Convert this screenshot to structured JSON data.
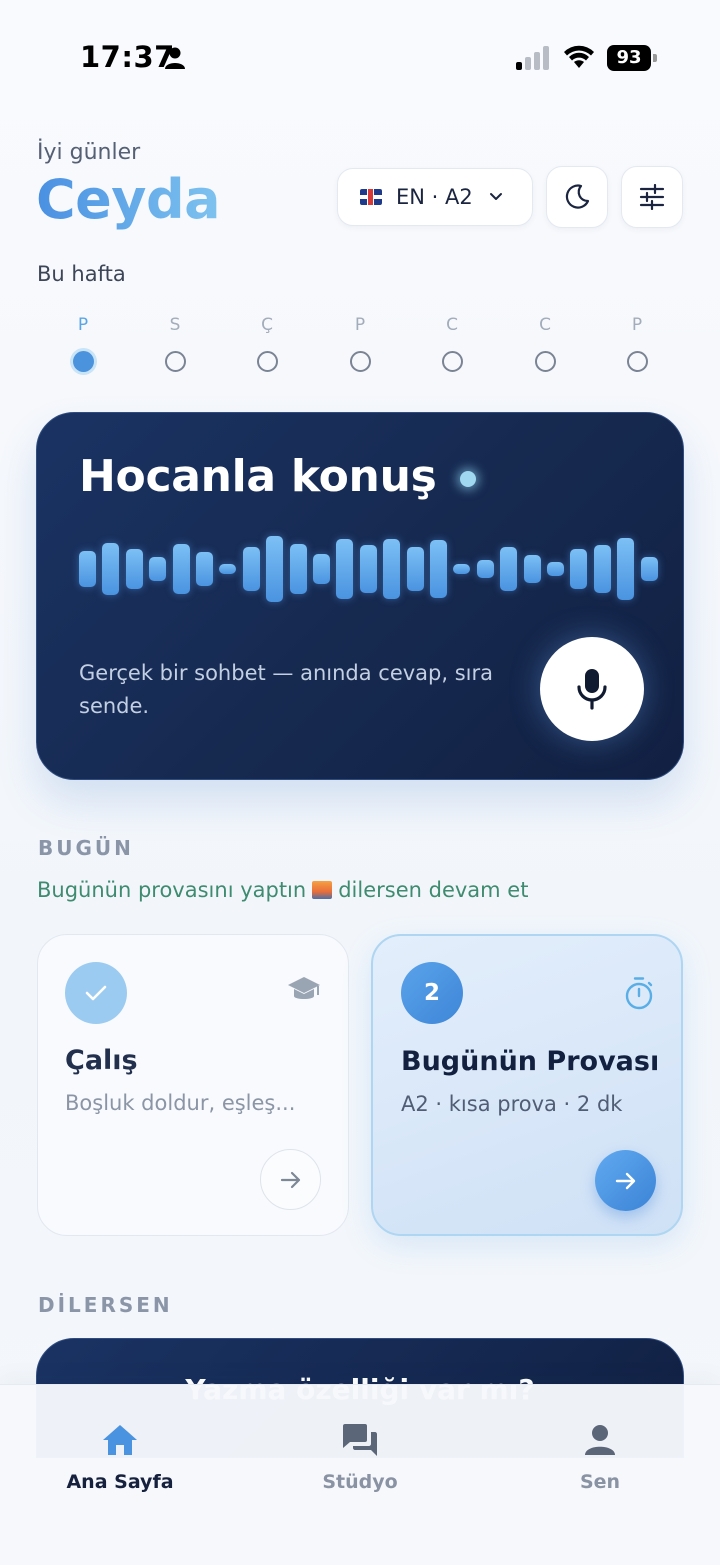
{
  "status_bar": {
    "time": "17:37",
    "battery": "93"
  },
  "header": {
    "greeting": "İyi günler",
    "user_name": "Ceyda",
    "language_selector": "EN · A2"
  },
  "week": {
    "label": "Bu hafta",
    "days": [
      {
        "letter": "P",
        "active": true
      },
      {
        "letter": "S",
        "active": false
      },
      {
        "letter": "Ç",
        "active": false
      },
      {
        "letter": "P",
        "active": false
      },
      {
        "letter": "C",
        "active": false
      },
      {
        "letter": "C",
        "active": false
      },
      {
        "letter": "P",
        "active": false
      }
    ]
  },
  "hero": {
    "title": "Hocanla konuş",
    "description": "Gerçek bir sohbet — anında cevap, sıra sende."
  },
  "today": {
    "section_title": "BUGÜN",
    "note_part1": "Bugünün provasını yaptın",
    "note_part2": "dilersen devam et",
    "cards": {
      "study": {
        "title": "Çalış",
        "subtitle": "Boşluk doldur, eşleş..."
      },
      "rehearsal": {
        "badge": "2",
        "title": "Bugünün Provası",
        "subtitle": "A2 · kısa prova · 2 dk"
      }
    }
  },
  "optional": {
    "section_title": "DİLERSEN",
    "promo_title": "Yazma özelliği var mı?"
  },
  "tabbar": {
    "tabs": [
      {
        "label": "Ana Sayfa",
        "icon": "home-icon",
        "active": true
      },
      {
        "label": "Stüdyo",
        "icon": "chat-icon",
        "active": false
      },
      {
        "label": "Sen",
        "icon": "profile-icon",
        "active": false
      }
    ]
  },
  "colors": {
    "accent": "#4b93dd",
    "hero_bg": "#16294f",
    "success_text": "#3e8b6f"
  }
}
